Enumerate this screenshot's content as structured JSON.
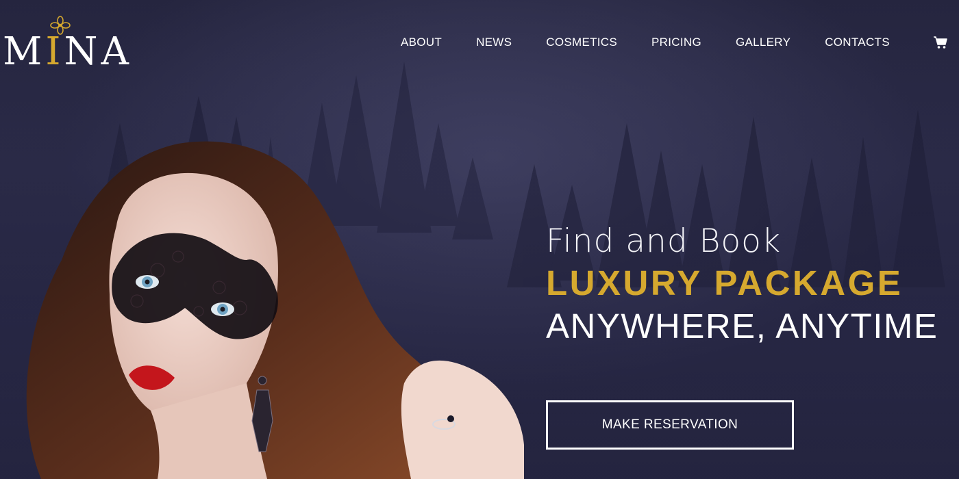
{
  "brand": {
    "name_before_accent": "M",
    "name_accent": "I",
    "name_after_accent": "NA",
    "accent_color": "#d6a92f",
    "emblem_icon": "flower-ornament-icon"
  },
  "nav": {
    "items": [
      {
        "label": "ABOUT"
      },
      {
        "label": "NEWS"
      },
      {
        "label": "COSMETICS"
      },
      {
        "label": "PRICING"
      },
      {
        "label": "GALLERY"
      },
      {
        "label": "CONTACTS"
      }
    ],
    "cart_icon": "shopping-cart-icon"
  },
  "hero": {
    "line1": "Find and Book",
    "line2": "LUXURY PACKAGE",
    "line3": "ANYWHERE, ANYTIME",
    "cta_label": "MAKE RESERVATION",
    "image": "woman-with-lace-mask-photo",
    "background": "misty-pine-forest-photo"
  },
  "colors": {
    "background": "#262640",
    "accent": "#d6a92f",
    "text": "#ffffff"
  }
}
